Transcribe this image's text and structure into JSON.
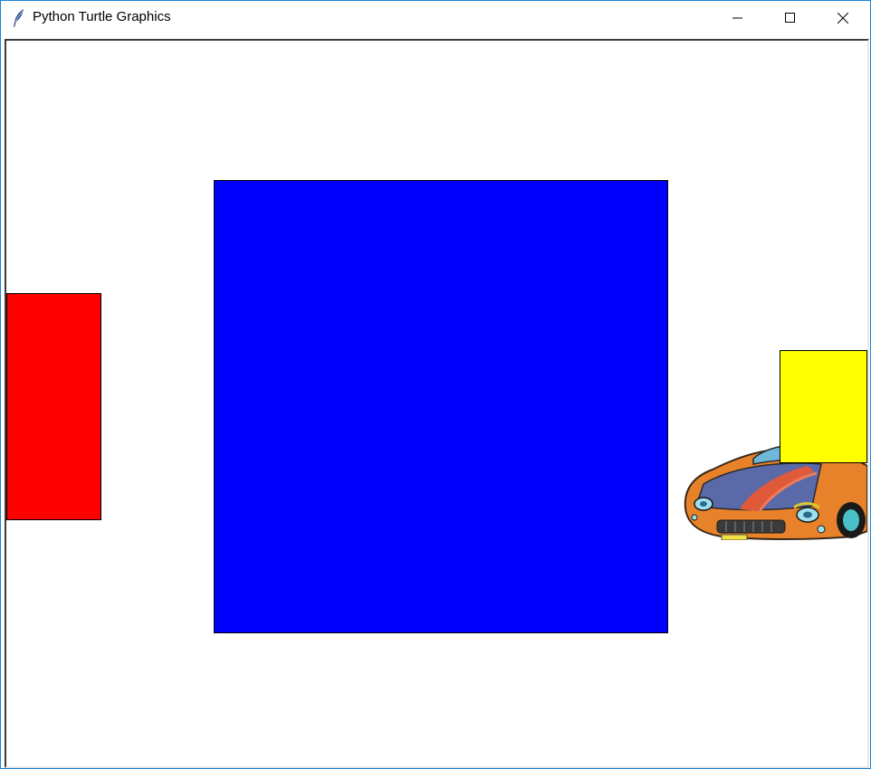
{
  "window": {
    "title": "Python Turtle Graphics",
    "icon": "feather-icon",
    "controls": [
      "minimize-icon",
      "maximize-icon",
      "close-icon"
    ]
  },
  "canvas": {
    "background": "#ffffff",
    "shapes": [
      {
        "name": "red-rectangle",
        "color": "#ff0000"
      },
      {
        "name": "blue-square",
        "color": "#0000ff"
      },
      {
        "name": "yellow-rectangle",
        "color": "#ffff00"
      }
    ],
    "image": {
      "name": "orange-sports-car"
    }
  }
}
